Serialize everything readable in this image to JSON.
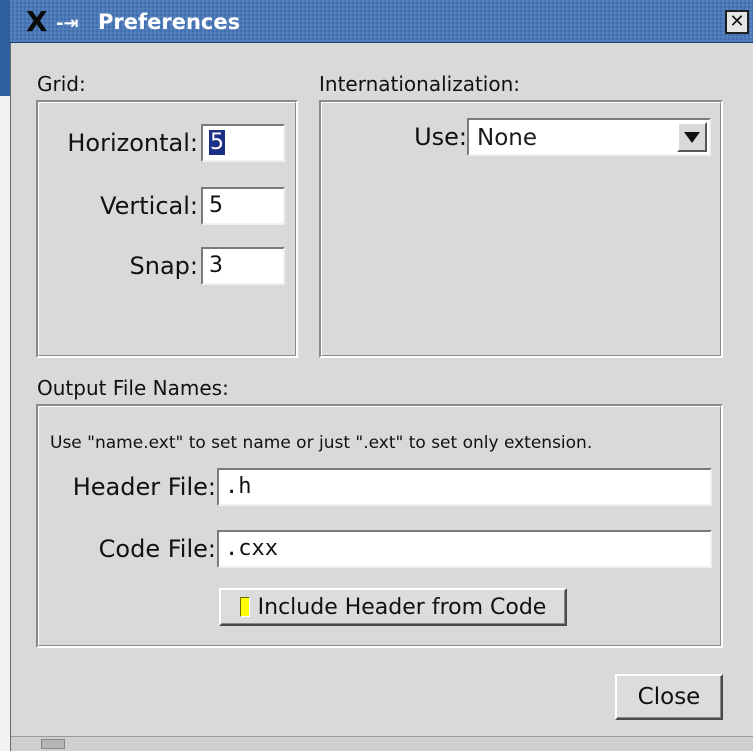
{
  "window": {
    "title": "Preferences",
    "window_icon": "x-pin-icon",
    "close_icon": "close-icon"
  },
  "grid": {
    "label": "Grid:",
    "horizontal_label": "Horizontal:",
    "horizontal_value": "5",
    "vertical_label": "Vertical:",
    "vertical_value": "5",
    "snap_label": "Snap:",
    "snap_value": "3"
  },
  "i18n": {
    "label": "Internationalization:",
    "use_label": "Use:",
    "use_value": "None"
  },
  "output": {
    "label": "Output File Names:",
    "hint": "Use \"name.ext\" to set name or just \".ext\" to set only extension.",
    "header_label": "Header File:",
    "header_value": ".h",
    "code_label": "Code File:",
    "code_value": ".cxx",
    "include_label": "Include Header from Code",
    "include_checked": true,
    "include_light_color": "#ffff00"
  },
  "footer": {
    "close_label": "Close"
  },
  "colors": {
    "titlebar": "#3f6fb1",
    "selection": "#1b2f86",
    "background": "#d9d9d9"
  }
}
